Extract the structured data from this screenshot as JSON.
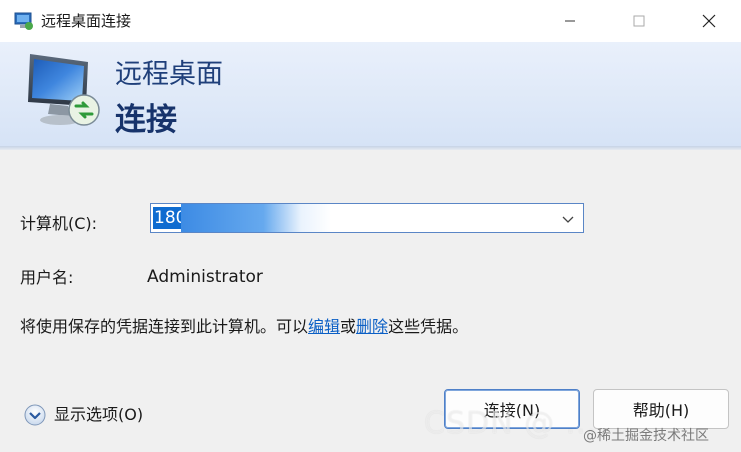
{
  "window": {
    "title": "远程桌面连接",
    "controls": [
      "minimize-icon",
      "maximize-icon",
      "close-icon"
    ]
  },
  "banner": {
    "line1": "远程桌面",
    "line2": "连接",
    "icon": "remote-desktop-monitor-icon"
  },
  "form": {
    "computer_label": "计算机(C):",
    "computer_value": "180",
    "user_label": "用户名:",
    "user_value": "Administrator",
    "info_prefix": "将使用保存的凭据连接到此计算机。可以",
    "edit_link": "编辑",
    "or_text": "或",
    "delete_link": "删除",
    "info_suffix": "这些凭据。"
  },
  "footer": {
    "show_options": "显示选项(O)",
    "connect_button": "连接(N)",
    "help_button": "帮助(H)"
  },
  "watermark": {
    "text": "CSDN @ ...",
    "secondary": "@稀土掘金技术社区"
  },
  "colors": {
    "accent": "#0f6cd0",
    "banner_text": "#1f3f7a",
    "link": "#0b5fc5"
  }
}
